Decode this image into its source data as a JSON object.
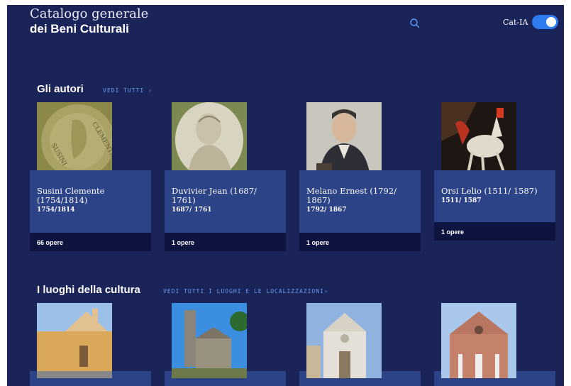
{
  "header": {
    "logo_line1": "Catalogo generale",
    "logo_line2": "dei Beni Culturali",
    "search_icon": "search-icon",
    "toggle_label": "Cat-IA",
    "toggle_on": true
  },
  "colors": {
    "background": "#1b2459",
    "card": "#2d4387",
    "card_footer": "#0d1440",
    "accent": "#2f7bf0",
    "link": "#6d9be8"
  },
  "authors": {
    "title": "Gli autori",
    "see_all": "VEDI TUTTI ›",
    "items": [
      {
        "name": "Susini Clemente (1754/1814)",
        "dates": "1754/1814",
        "works": "66 opere",
        "image": "medal-portrait"
      },
      {
        "name": "Duvivier Jean (1687/ 1761)",
        "dates": "1687/ 1761",
        "works": "1 opere",
        "image": "drawn-portrait"
      },
      {
        "name": "Melano Ernest (1792/ 1867)",
        "dates": "1792/ 1867",
        "works": "1 opere",
        "image": "painted-portrait"
      },
      {
        "name": "Orsi Lelio (1511/ 1587)",
        "dates": "1511/ 1587",
        "works": "1 opere",
        "image": "painting-horseman"
      }
    ]
  },
  "places": {
    "title": "I luoghi della cultura",
    "see_all": "VEDI TUTTI I LUOGHI E LE LOCALIZZAZIONI›",
    "items": [
      {
        "image": "church-yellow"
      },
      {
        "image": "church-bell-tower"
      },
      {
        "image": "church-white-facade"
      },
      {
        "image": "church-red-brick"
      }
    ]
  }
}
